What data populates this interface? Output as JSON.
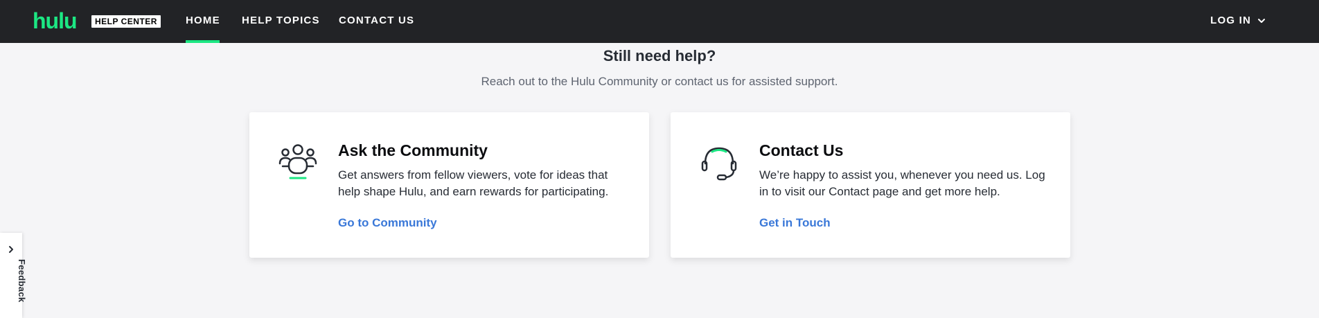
{
  "header": {
    "logo": "hulu",
    "badge": "HELP CENTER",
    "nav": {
      "home": "HOME",
      "topics": "HELP TOPICS",
      "contact": "CONTACT US"
    },
    "login": "LOG IN"
  },
  "section": {
    "title": "Still need help?",
    "subtitle": "Reach out to the Hulu Community or contact us for assisted support."
  },
  "cards": [
    {
      "title": "Ask the Community",
      "description": "Get answers from fellow viewers, vote for ideas that help shape Hulu, and earn rewards for participating.",
      "link": "Go to Community",
      "icon": "community-icon"
    },
    {
      "title": "Contact Us",
      "description": "We’re happy to assist you, whenever you need us. Log in to visit our Contact page and get more help.",
      "link": "Get in Touch",
      "icon": "headset-icon"
    }
  ],
  "feedback": {
    "label": "Feedback"
  },
  "colors": {
    "brand": "#1ce783",
    "header_bg": "#222326",
    "link": "#3a78d8",
    "page_bg": "#f5f5f7"
  }
}
